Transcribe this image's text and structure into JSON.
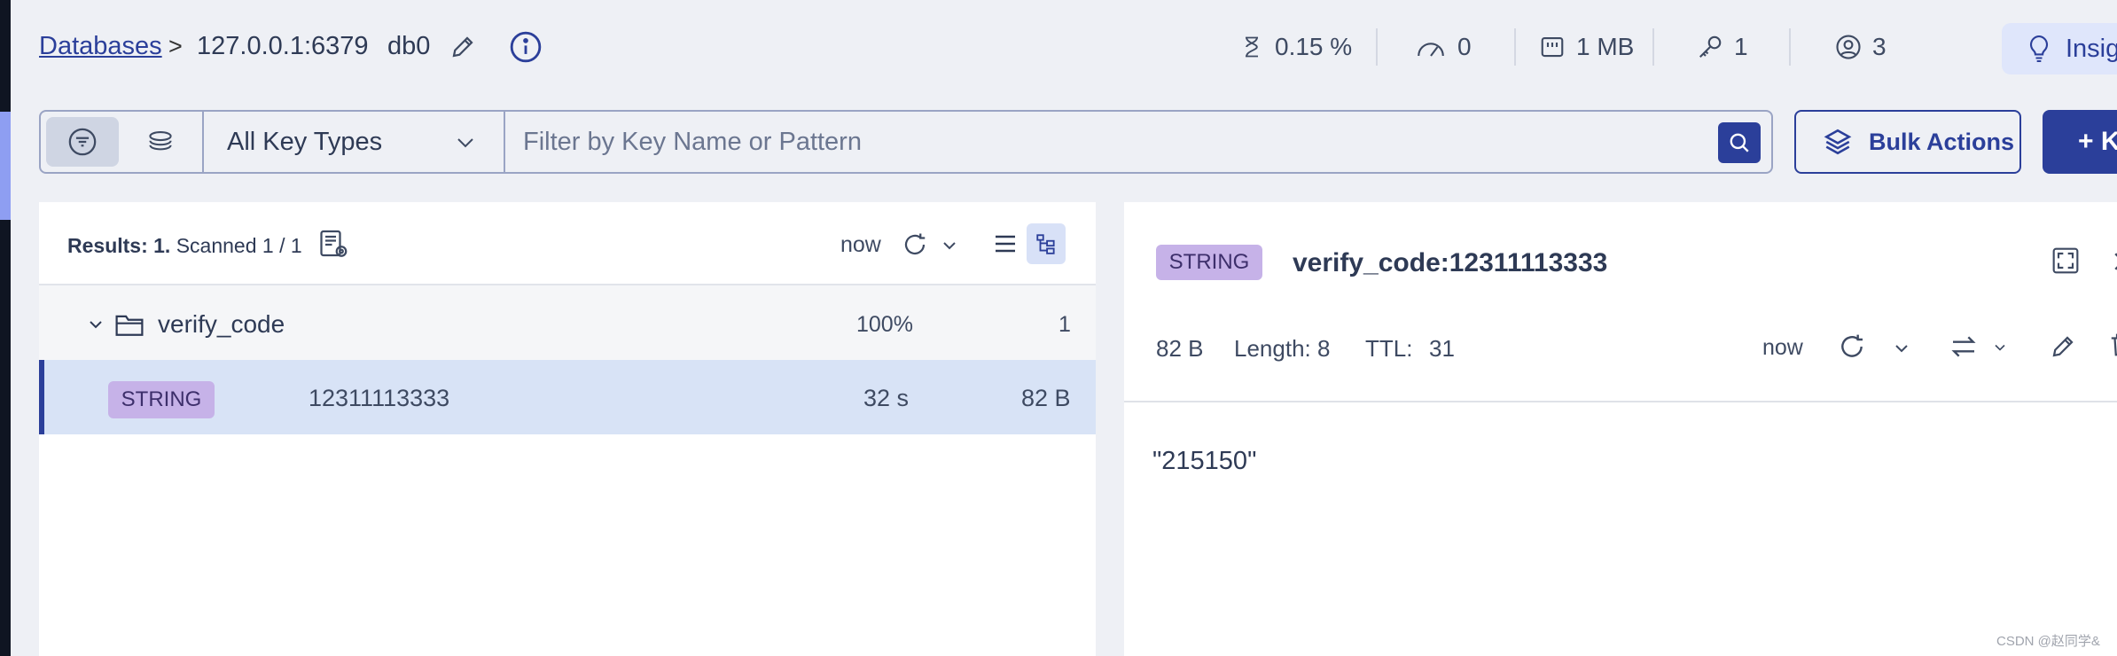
{
  "header": {
    "breadcrumb_link": "Databases",
    "breadcrumb_sep": ">",
    "host": "127.0.0.1:6379",
    "db": "db0",
    "stats": {
      "cpu": "0.15 %",
      "commands": "0",
      "memory": "1 MB",
      "keys": "1",
      "clients": "3"
    },
    "insights_label": "Insig"
  },
  "filter": {
    "key_type": "All Key Types",
    "placeholder": "Filter by Key Name or Pattern",
    "bulk_label": "Bulk Actions",
    "add_label": "+ K"
  },
  "list": {
    "results_label": "Results: 1.",
    "scanned_label": "Scanned 1 / 1",
    "refresh_time": "now",
    "folder": {
      "name": "verify_code",
      "percent": "100%",
      "count": "1"
    },
    "rows": [
      {
        "type": "STRING",
        "name": "12311113333",
        "ttl": "32 s",
        "size": "82 B"
      }
    ]
  },
  "detail": {
    "type": "STRING",
    "key": "verify_code:12311113333",
    "size": "82 B",
    "length": "Length: 8",
    "ttl_label": "TTL:",
    "ttl_value": "31",
    "refresh_time": "now",
    "value": "\"215150\""
  },
  "watermark": "CSDN @赵同学&",
  "colors": {
    "brand": "#2b3f9a",
    "string_badge": "#c6b2e8",
    "selected_row": "#d8e3f6",
    "background": "#eef0f5"
  }
}
